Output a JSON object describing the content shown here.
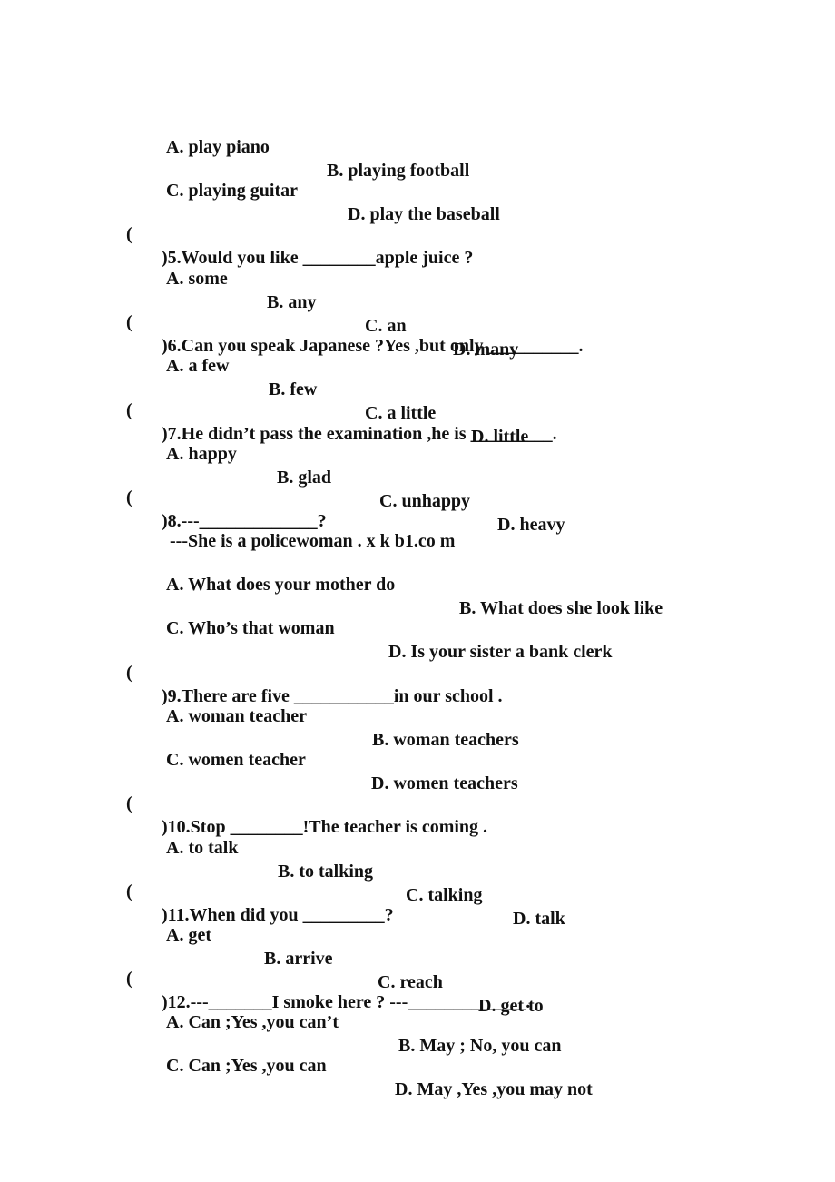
{
  "document": {
    "items": [
      {
        "type": "options-continued",
        "options": [
          "A. play piano",
          "B. playing football",
          "C. playing guitar",
          "D. play the baseball"
        ]
      },
      {
        "number": "5",
        "paren": "(",
        "question": ")5.Would you like ________apple juice ?",
        "options": [
          "A. some",
          "B. any",
          "C. an",
          "D. many"
        ]
      },
      {
        "number": "6",
        "paren": "(",
        "question": ")6.Can you speak Japanese ?Yes ,but only __________.",
        "options": [
          "A. a few",
          "B. few",
          "C. a little",
          "D. little"
        ]
      },
      {
        "number": "7",
        "paren": "(",
        "question": ")7.He didn’t pass the examination ,he is _________.",
        "options": [
          "A. happy",
          "B. glad",
          "C. unhappy",
          "D. heavy"
        ]
      },
      {
        "number": "8",
        "paren": "(",
        "question": ")8.---_____________?",
        "answer_line": "---She is a policewoman . x k b1.co m",
        "options": [
          "A. What does your mother do",
          "B. What does she look like",
          "C. Who’s that woman",
          "D. Is your sister a bank clerk"
        ]
      },
      {
        "number": "9",
        "paren": "(",
        "question": ")9.There are five ___________in our school .",
        "options": [
          "A. woman teacher",
          "B. woman teachers",
          "C. women teacher",
          "D. women teachers"
        ]
      },
      {
        "number": "10",
        "paren": "(",
        "question": ")10.Stop ________!The teacher is coming .",
        "options": [
          "A. to talk",
          "B. to talking",
          "C. talking",
          "D. talk"
        ]
      },
      {
        "number": "11",
        "paren": "(",
        "question": ")11.When did you _________?",
        "options": [
          "A. get",
          "B. arrive",
          "C. reach",
          "D. get to"
        ]
      },
      {
        "number": "12",
        "paren": "(",
        "question": ")12.---_______I smoke here ? ---_____________.",
        "options": [
          "A. Can ;Yes ,you can’t",
          "B. May ; No, you can",
          "C. Can ;Yes ,you can",
          "D. May ,Yes ,you may not"
        ]
      }
    ]
  }
}
